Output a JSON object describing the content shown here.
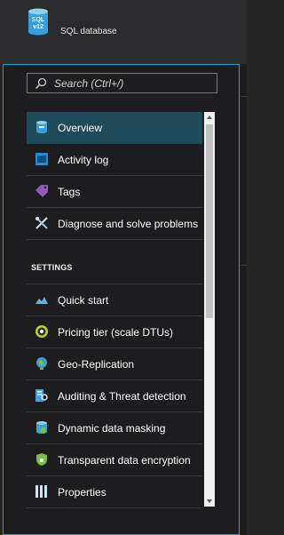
{
  "header": {
    "icon_text_top": "SQL",
    "icon_text_bottom": "v12",
    "title": "SQL database"
  },
  "search": {
    "placeholder": "Search (Ctrl+/)",
    "icon": "search-icon"
  },
  "menu": {
    "items": [
      {
        "label": "Overview",
        "icon": "sql-database-icon",
        "active": true
      },
      {
        "label": "Activity log",
        "icon": "activity-log-icon"
      },
      {
        "label": "Tags",
        "icon": "tag-icon"
      },
      {
        "label": "Diagnose and solve problems",
        "icon": "wrench-icon"
      }
    ],
    "section_title": "SETTINGS",
    "settings_items": [
      {
        "label": "Quick start",
        "icon": "cloud-icon"
      },
      {
        "label": "Pricing tier (scale DTUs)",
        "icon": "pricing-icon"
      },
      {
        "label": "Geo-Replication",
        "icon": "globe-icon"
      },
      {
        "label": "Auditing & Threat detection",
        "icon": "auditing-icon"
      },
      {
        "label": "Dynamic data masking",
        "icon": "masking-icon"
      },
      {
        "label": "Transparent data encryption",
        "icon": "shield-icon"
      },
      {
        "label": "Properties",
        "icon": "properties-icon"
      }
    ]
  },
  "colors": {
    "accent": "#1fa0d8",
    "active_bg": "#1e4a5a",
    "background": "#1d1d1f"
  }
}
